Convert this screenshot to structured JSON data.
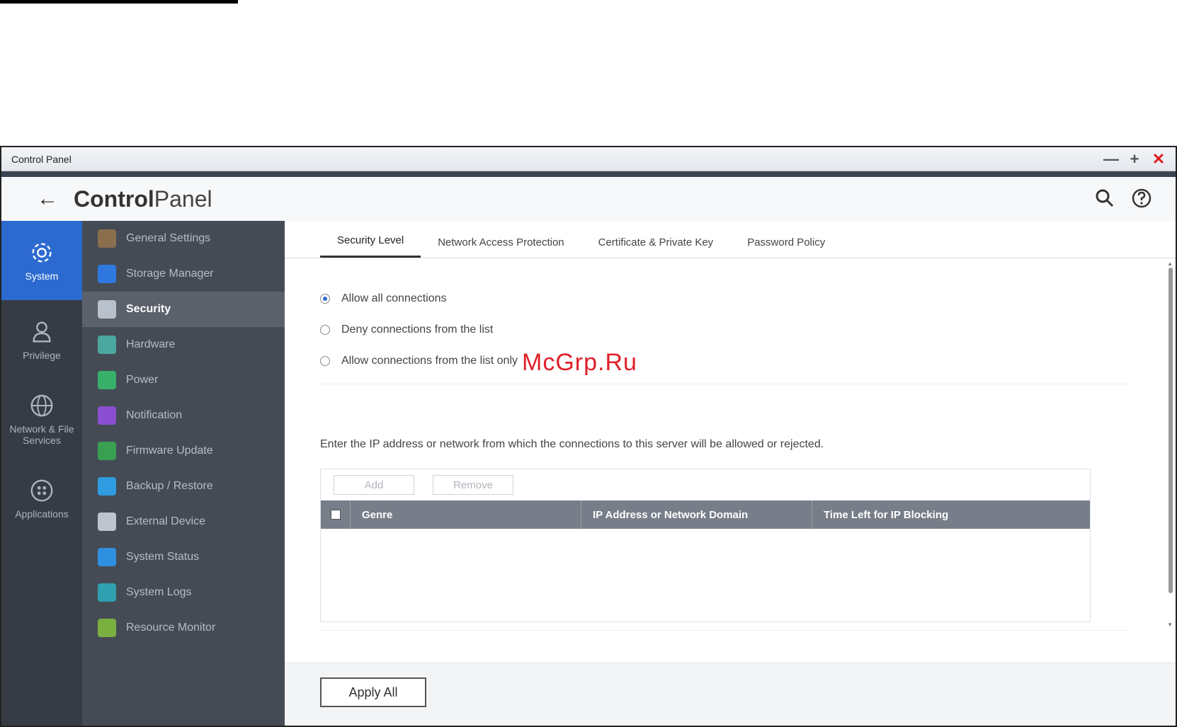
{
  "window": {
    "title": "Control Panel",
    "controls": [
      "minimize-icon",
      "maximize-icon",
      "close-icon"
    ]
  },
  "header": {
    "brand_bold": "Control",
    "brand_light": "Panel",
    "icons": [
      "search-icon",
      "help-icon"
    ]
  },
  "leftnav": {
    "items": [
      {
        "label": "System",
        "icon": "gear-icon",
        "active": true
      },
      {
        "label": "Privilege",
        "icon": "user-icon"
      },
      {
        "label": "Network & File Services",
        "icon": "globe-icon"
      },
      {
        "label": "Applications",
        "icon": "apps-icon"
      }
    ]
  },
  "sidemenu": {
    "items": [
      {
        "label": "General Settings",
        "color": "#8a6e4e"
      },
      {
        "label": "Storage Manager",
        "color": "#2f78e0"
      },
      {
        "label": "Security",
        "color": "#b8c0cc",
        "active": true
      },
      {
        "label": "Hardware",
        "color": "#4aa8a0"
      },
      {
        "label": "Power",
        "color": "#38b06a"
      },
      {
        "label": "Notification",
        "color": "#8a4fd0"
      },
      {
        "label": "Firmware Update",
        "color": "#38a050"
      },
      {
        "label": "Backup / Restore",
        "color": "#2f9be0"
      },
      {
        "label": "External Device",
        "color": "#bfc4cc"
      },
      {
        "label": "System Status",
        "color": "#2f90e0"
      },
      {
        "label": "System Logs",
        "color": "#2ea0b0"
      },
      {
        "label": "Resource Monitor",
        "color": "#7ab040"
      }
    ]
  },
  "tabs": [
    {
      "label": "Security Level",
      "active": true
    },
    {
      "label": "Network Access Protection"
    },
    {
      "label": "Certificate & Private Key"
    },
    {
      "label": "Password Policy"
    }
  ],
  "radios": [
    {
      "label": "Allow all connections",
      "checked": true
    },
    {
      "label": "Deny connections from the list"
    },
    {
      "label": "Allow connections from the list only"
    }
  ],
  "info_text": "Enter the IP address or network from which the connections to this server will be allowed or rejected.",
  "toolbar": {
    "add_label": "Add",
    "remove_label": "Remove"
  },
  "table": {
    "columns": [
      "Genre",
      "IP Address or Network Domain",
      "Time Left for IP Blocking"
    ],
    "rows": []
  },
  "footer": {
    "apply_label": "Apply All"
  },
  "watermark": "McGrp.Ru",
  "colors": {
    "accent": "#2d6ad0",
    "sidebar_dark": "#363b44",
    "menu_bg": "#454b55",
    "close": "#e02020",
    "watermark": "#e0202a"
  }
}
